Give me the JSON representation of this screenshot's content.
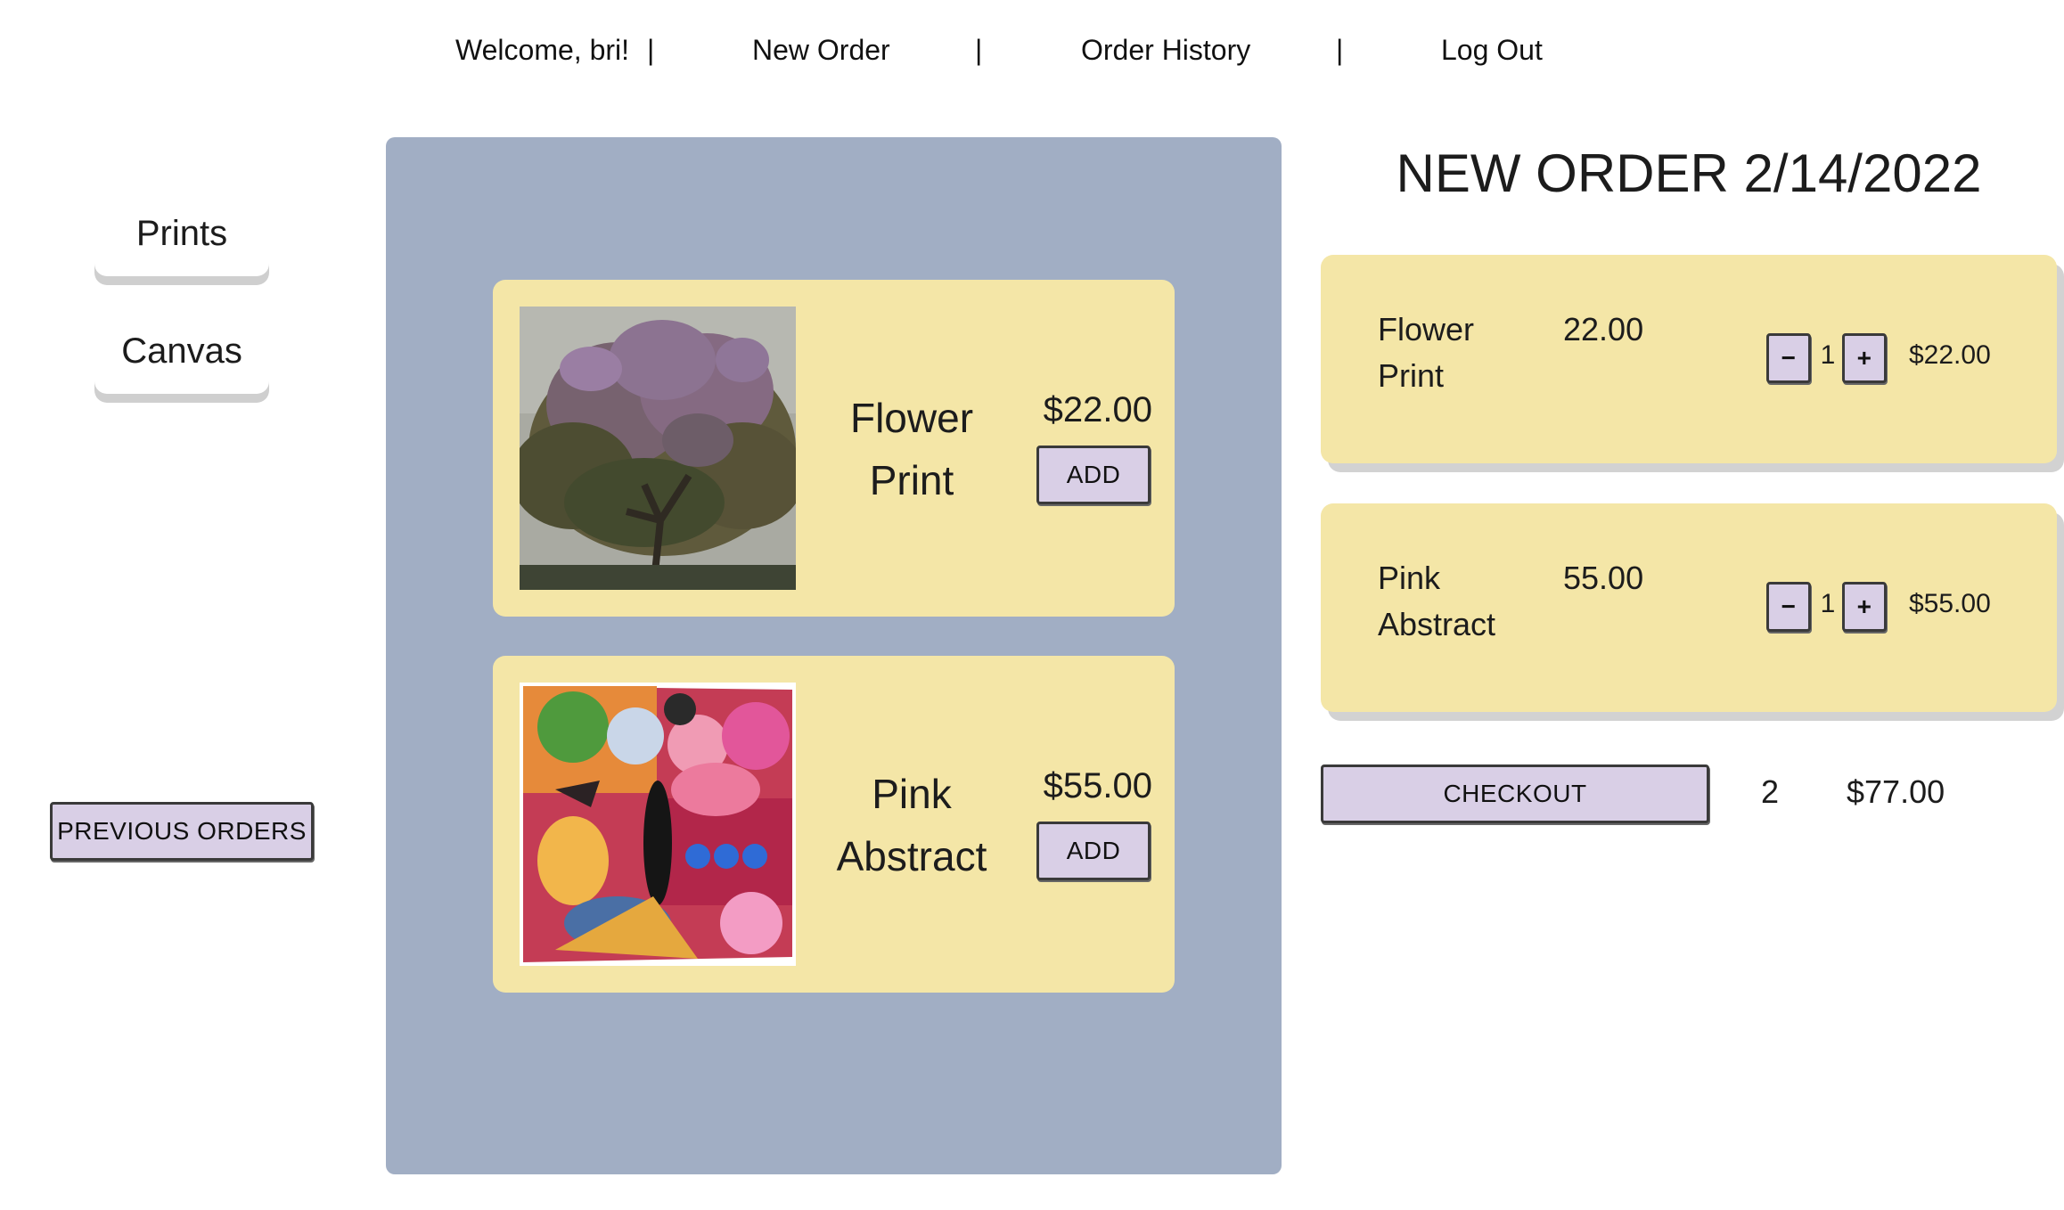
{
  "nav": {
    "welcome": "Welcome, bri!",
    "separator": "|",
    "new_order": "New Order",
    "order_history": "Order History",
    "log_out": "Log Out"
  },
  "sidebar": {
    "categories": [
      {
        "label": "Prints"
      },
      {
        "label": "Canvas"
      }
    ],
    "previous_orders_label": "PREVIOUS ORDERS"
  },
  "products": [
    {
      "name_line1": "Flower",
      "name_line2": "Print",
      "price": "$22.00",
      "add_label": "ADD",
      "image": "flowering-tree-photo"
    },
    {
      "name_line1": "Pink",
      "name_line2": "Abstract",
      "price": "$55.00",
      "add_label": "ADD",
      "image": "colorful-abstract-canvas"
    }
  ],
  "order": {
    "title": "NEW ORDER 2/14/2022",
    "lines": [
      {
        "name_line1": "Flower",
        "name_line2": "Print",
        "unit_price": "22.00",
        "qty": "1",
        "total": "$22.00",
        "minus": "−",
        "plus": "+"
      },
      {
        "name_line1": "Pink",
        "name_line2": "Abstract",
        "unit_price": "55.00",
        "qty": "1",
        "total": "$55.00",
        "minus": "−",
        "plus": "+"
      }
    ],
    "checkout_label": "CHECKOUT",
    "item_count": "2",
    "grand_total": "$77.00"
  },
  "colors": {
    "panel": "#a1aec4",
    "card": "#f4e6a7",
    "button": "#d9cfe6"
  }
}
